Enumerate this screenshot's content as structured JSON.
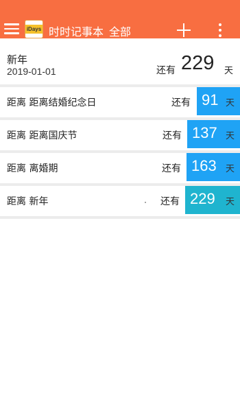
{
  "header": {
    "logo_text": "iDays",
    "title": "时时记事本",
    "filter": "全部",
    "color": "#f86e41"
  },
  "featured": {
    "name": "新年",
    "date": "2019-01-01",
    "remain_label": "还有",
    "days": "229",
    "unit": "天"
  },
  "events": [
    {
      "label": "距离 距离结婚纪念日",
      "remain_label": "还有",
      "days": "91",
      "unit": "天",
      "color": "#1fa3f5"
    },
    {
      "label": "距离 距离国庆节",
      "remain_label": "还有",
      "days": "137",
      "unit": "天",
      "color": "#1fa3f5"
    },
    {
      "label": "距离 离婚期",
      "remain_label": "还有",
      "days": "163",
      "unit": "天",
      "color": "#1fa3f5"
    },
    {
      "label": "距离 新年",
      "remain_label": "还有",
      "days": "229",
      "unit": "天",
      "color": "#1fb4cf"
    }
  ],
  "icons": {
    "menu": "hamburger-menu-icon",
    "add": "plus-icon",
    "more": "vertical-dots-icon"
  }
}
